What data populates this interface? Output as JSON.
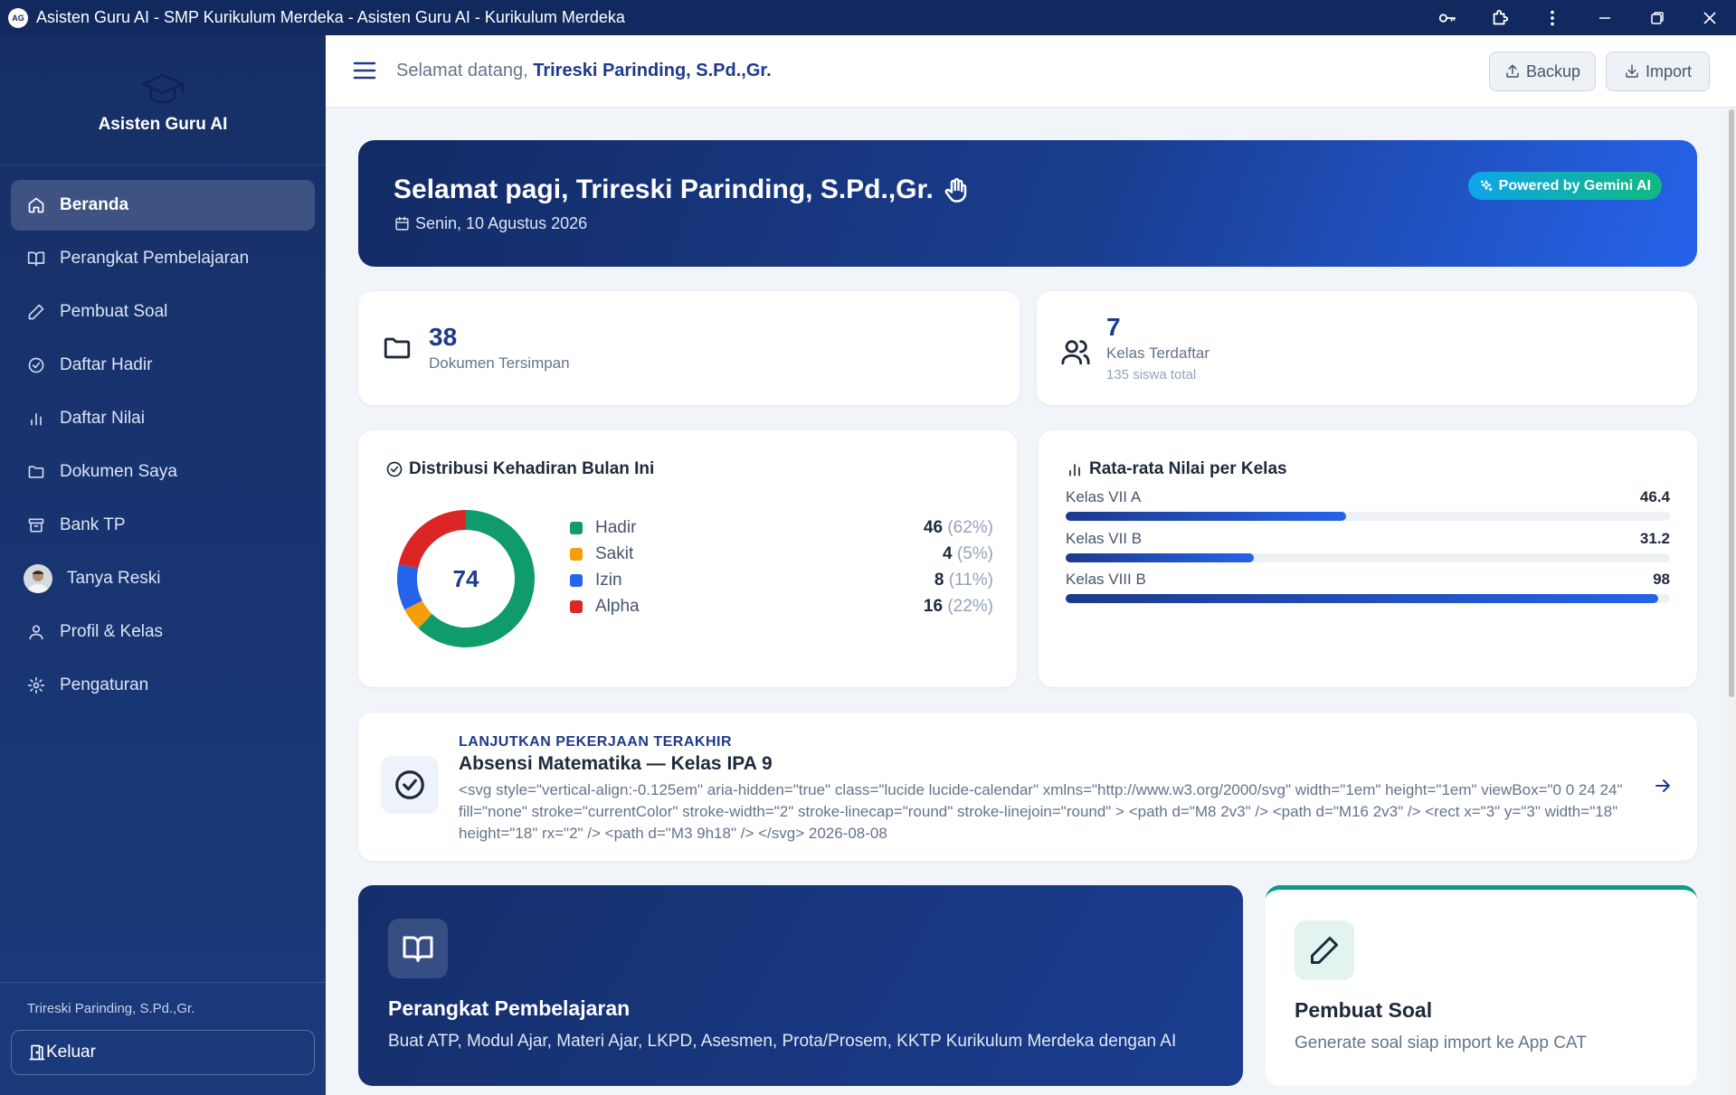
{
  "window": {
    "title": "Asisten Guru AI - SMP Kurikulum Merdeka - Asisten Guru AI - Kurikulum Merdeka",
    "app_icon_text": "AG"
  },
  "sidebar": {
    "brand": "Asisten Guru AI",
    "items": [
      {
        "label": "Beranda",
        "icon": "home-icon",
        "active": true
      },
      {
        "label": "Perangkat Pembelajaran",
        "icon": "book-open-icon"
      },
      {
        "label": "Pembuat Soal",
        "icon": "pen-icon"
      },
      {
        "label": "Daftar Hadir",
        "icon": "check-circle-icon"
      },
      {
        "label": "Daftar Nilai",
        "icon": "bar-chart-icon"
      },
      {
        "label": "Dokumen Saya",
        "icon": "folder-icon"
      },
      {
        "label": "Bank TP",
        "icon": "archive-icon"
      },
      {
        "label": "Tanya Reski",
        "icon": "avatar"
      },
      {
        "label": "Profil & Kelas",
        "icon": "user-icon"
      },
      {
        "label": "Pengaturan",
        "icon": "gear-icon"
      }
    ],
    "user_name": "Trireski Parinding, S.Pd.,Gr.",
    "logout_label": "Keluar"
  },
  "header": {
    "welcome_prefix": "Selamat datang,",
    "welcome_name": "Trireski Parinding, S.Pd.,Gr.",
    "backup_label": "Backup",
    "import_label": "Import"
  },
  "hero": {
    "greeting": "Selamat pagi, Trireski Parinding, S.Pd.,Gr.",
    "date": "Senin, 10 Agustus 2026",
    "badge": "Powered by Gemini AI"
  },
  "stats": {
    "documents": {
      "value": "38",
      "label": "Dokumen Tersimpan"
    },
    "classes": {
      "value": "7",
      "label": "Kelas Terdaftar",
      "sub": "135 siswa total"
    }
  },
  "attendance": {
    "title": "Distribusi Kehadiran Bulan Ini",
    "total": "74",
    "items": [
      {
        "label": "Hadir",
        "value": "46",
        "pct": "(62%)",
        "color": "#0f9b6a"
      },
      {
        "label": "Sakit",
        "value": "4",
        "pct": "(5%)",
        "color": "#f59e0b"
      },
      {
        "label": "Izin",
        "value": "8",
        "pct": "(11%)",
        "color": "#2563eb"
      },
      {
        "label": "Alpha",
        "value": "16",
        "pct": "(22%)",
        "color": "#dc2626"
      }
    ]
  },
  "grades": {
    "title": "Rata-rata Nilai per Kelas",
    "rows": [
      {
        "label": "Kelas VII A",
        "value": "46.4",
        "fraction": 0.464
      },
      {
        "label": "Kelas VII B",
        "value": "31.2",
        "fraction": 0.312
      },
      {
        "label": "Kelas VIII B",
        "value": "98",
        "fraction": 0.98
      }
    ]
  },
  "continue_card": {
    "kicker": "LANJUTKAN PEKERJAAN TERAKHIR",
    "title": "Absensi Matematika — Kelas IPA 9",
    "description": "<svg style=\"vertical-align:-0.125em\" aria-hidden=\"true\" class=\"lucide lucide-calendar\" xmlns=\"http://www.w3.org/2000/svg\" width=\"1em\" height=\"1em\" viewBox=\"0 0 24 24\" fill=\"none\" stroke=\"currentColor\" stroke-width=\"2\" stroke-linecap=\"round\" stroke-linejoin=\"round\" > <path d=\"M8 2v3\" /> <path d=\"M16 2v3\" /> <rect x=\"3\" y=\"3\" width=\"18\" height=\"18\" rx=\"2\" /> <path d=\"M3 9h18\" /> </svg> 2026-08-08"
  },
  "features": [
    {
      "title": "Perangkat Pembelajaran",
      "desc": "Buat ATP, Modul Ajar, Materi Ajar, LKPD, Asesmen, Prota/Prosem, KKTP Kurikulum Merdeka dengan AI",
      "icon": "book-open-icon"
    },
    {
      "title": "Pembuat Soal",
      "desc": "Generate soal siap import ke App CAT",
      "icon": "pen-icon",
      "accent": "#0f9b87"
    }
  ]
}
